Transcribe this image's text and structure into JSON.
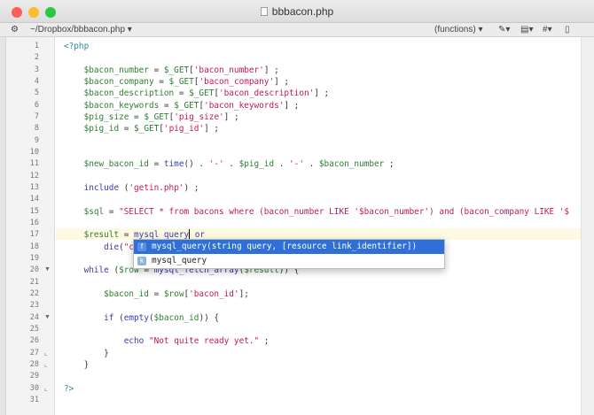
{
  "window": {
    "title": "bbbacon.php"
  },
  "navbar": {
    "path": "~/Dropbox/bbbacon.php",
    "functions": "(functions)",
    "gear": "gear-icon",
    "pen": "pen-icon",
    "doc": "document-icon",
    "hash": "#"
  },
  "colors": {
    "close": "#fc5f57",
    "min": "#fdbc2e",
    "max": "#28c840",
    "selection": "#2f6fd8"
  },
  "lines": [
    [
      [
        "t-tag",
        "<?php"
      ]
    ],
    [],
    [
      [
        "",
        "    "
      ],
      [
        "t-var",
        "$bacon_number"
      ],
      [
        "",
        " = "
      ],
      [
        "t-var",
        "$_GET"
      ],
      [
        "",
        "["
      ],
      [
        "t-str",
        "'bacon_number'"
      ],
      [
        "",
        "] ;"
      ]
    ],
    [
      [
        "",
        "    "
      ],
      [
        "t-var",
        "$bacon_company"
      ],
      [
        "",
        " = "
      ],
      [
        "t-var",
        "$_GET"
      ],
      [
        "",
        "["
      ],
      [
        "t-str",
        "'bacon_company'"
      ],
      [
        "",
        "] ;"
      ]
    ],
    [
      [
        "",
        "    "
      ],
      [
        "t-var",
        "$bacon_description"
      ],
      [
        "",
        " = "
      ],
      [
        "t-var",
        "$_GET"
      ],
      [
        "",
        "["
      ],
      [
        "t-str",
        "'bacon_description'"
      ],
      [
        "",
        "] ;"
      ]
    ],
    [
      [
        "",
        "    "
      ],
      [
        "t-var",
        "$bacon_keywords"
      ],
      [
        "",
        " = "
      ],
      [
        "t-var",
        "$_GET"
      ],
      [
        "",
        "["
      ],
      [
        "t-str",
        "'bacon_keywords'"
      ],
      [
        "",
        "] ;"
      ]
    ],
    [
      [
        "",
        "    "
      ],
      [
        "t-var",
        "$pig_size"
      ],
      [
        "",
        " = "
      ],
      [
        "t-var",
        "$_GET"
      ],
      [
        "",
        "["
      ],
      [
        "t-str",
        "'pig_size'"
      ],
      [
        "",
        "] ;"
      ]
    ],
    [
      [
        "",
        "    "
      ],
      [
        "t-var",
        "$pig_id"
      ],
      [
        "",
        " = "
      ],
      [
        "t-var",
        "$_GET"
      ],
      [
        "",
        "["
      ],
      [
        "t-str",
        "'pig_id'"
      ],
      [
        "",
        "] ;"
      ]
    ],
    [],
    [],
    [
      [
        "",
        "    "
      ],
      [
        "t-var",
        "$new_bacon_id"
      ],
      [
        "",
        " = "
      ],
      [
        "t-kw",
        "time"
      ],
      [
        "",
        "() . "
      ],
      [
        "t-str",
        "'-'"
      ],
      [
        "",
        " . "
      ],
      [
        "t-var",
        "$pig_id"
      ],
      [
        "",
        " . "
      ],
      [
        "t-str",
        "'-'"
      ],
      [
        "",
        " . "
      ],
      [
        "t-var",
        "$bacon_number"
      ],
      [
        "",
        " ;"
      ]
    ],
    [],
    [
      [
        "",
        "    "
      ],
      [
        "t-kw",
        "include"
      ],
      [
        "",
        " ("
      ],
      [
        "t-str",
        "'getin.php'"
      ],
      [
        "",
        ") ;"
      ]
    ],
    [],
    [
      [
        "",
        "    "
      ],
      [
        "t-var",
        "$sql"
      ],
      [
        "",
        " = "
      ],
      [
        "t-str",
        "\"SELECT * from bacons where (bacon_number LIKE '$bacon_number') and (bacon_company LIKE '$"
      ]
    ],
    [],
    [
      [
        "",
        "    "
      ],
      [
        "t-var",
        "$result"
      ],
      [
        "",
        " = "
      ],
      [
        "t-kw",
        "mysql_query"
      ],
      [
        "cursor",
        ""
      ],
      [
        "",
        " "
      ],
      [
        "t-kw",
        "or"
      ]
    ],
    [
      [
        "",
        "        "
      ],
      [
        "t-kw",
        "die"
      ],
      [
        "",
        "("
      ],
      [
        "t-str",
        "\"c"
      ]
    ],
    [],
    [
      [
        "",
        "    "
      ],
      [
        "t-kw",
        "while"
      ],
      [
        "",
        " ("
      ],
      [
        "t-var",
        "$row"
      ],
      [
        "",
        " = "
      ],
      [
        "t-kw",
        "mysql_fetch_array"
      ],
      [
        "",
        "("
      ],
      [
        "t-var",
        "$result"
      ],
      [
        "",
        ")) {"
      ]
    ],
    [],
    [
      [
        "",
        "        "
      ],
      [
        "t-var",
        "$bacon_id"
      ],
      [
        "",
        " = "
      ],
      [
        "t-var",
        "$row"
      ],
      [
        "",
        "["
      ],
      [
        "t-str",
        "'bacon_id'"
      ],
      [
        "",
        "];"
      ]
    ],
    [],
    [
      [
        "",
        "        "
      ],
      [
        "t-kw",
        "if"
      ],
      [
        "",
        " ("
      ],
      [
        "t-kw",
        "empty"
      ],
      [
        "",
        "("
      ],
      [
        "t-var",
        "$bacon_id"
      ],
      [
        "",
        ")) {"
      ]
    ],
    [],
    [
      [
        "",
        "            "
      ],
      [
        "t-kw",
        "echo"
      ],
      [
        "",
        " "
      ],
      [
        "t-str",
        "\"Not quite ready yet.\""
      ],
      [
        "",
        " ;"
      ]
    ],
    [
      [
        "",
        "        }"
      ]
    ],
    [
      [
        "",
        "    }"
      ]
    ],
    [],
    [
      [
        "t-tag",
        "?>"
      ]
    ],
    []
  ],
  "folds": {
    "20": "▼",
    "24": "▼",
    "27": "⌞",
    "28": "⌞",
    "30": "⌞"
  },
  "autocomplete": {
    "items": [
      {
        "icon": "f",
        "label": "mysql_query(string query, [resource link_identifier])",
        "selected": true
      },
      {
        "icon": "k",
        "label": "mysql_query",
        "selected": false
      }
    ]
  }
}
